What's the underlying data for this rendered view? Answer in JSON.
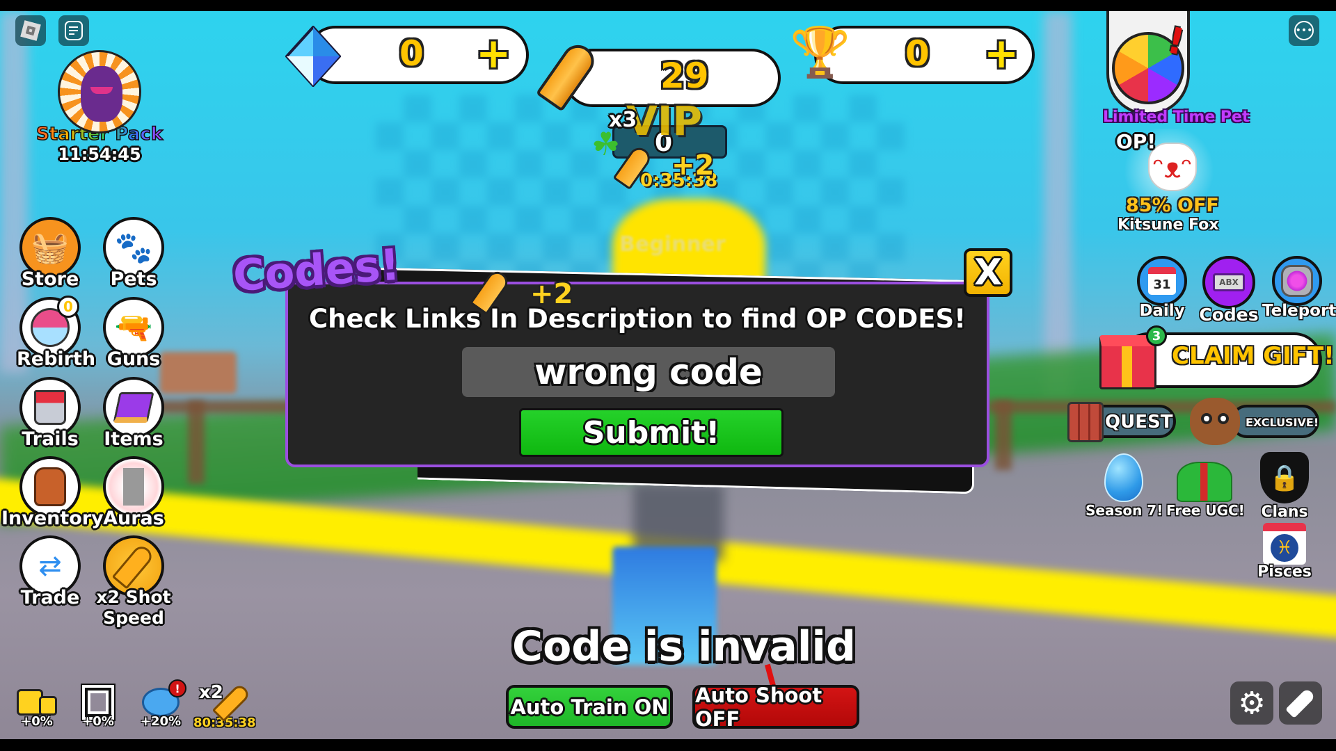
{
  "top_left": {
    "roblox_menu_icon": "roblox-logo-icon",
    "chat_icon": "chat-icon",
    "starter_pack": {
      "label": "Starter Pack",
      "timer": "11:54:45"
    }
  },
  "currencies": {
    "gems": {
      "value": "0",
      "plus": "+"
    },
    "bullets": {
      "value": "29"
    },
    "trophies": {
      "value": "0",
      "plus": "+"
    }
  },
  "hud_center": {
    "vip_label": "VIP",
    "luck_multiplier": "x3",
    "counter": "0",
    "bullet_gain": "+2",
    "timer_partial": "0:35:38",
    "rank_label": "Beginner"
  },
  "limited_pet": {
    "label": "Limited Time Pet",
    "alert": "!",
    "op_label": "OP!",
    "discount": "85% OFF",
    "pet_name": "Kitsune Fox"
  },
  "left_menu": [
    {
      "id": "store",
      "label": "Store",
      "icon": "basket"
    },
    {
      "id": "pets",
      "label": "Pets",
      "icon": "paw"
    },
    {
      "id": "rebirth",
      "label": "Rebirth",
      "icon": "rebirth",
      "badge": "0"
    },
    {
      "id": "guns",
      "label": "Guns",
      "icon": "pistol"
    },
    {
      "id": "trails",
      "label": "Trails",
      "icon": "paint-bucket"
    },
    {
      "id": "items",
      "label": "Items",
      "icon": "book"
    },
    {
      "id": "inventory",
      "label": "Inventory",
      "icon": "backpack"
    },
    {
      "id": "auras",
      "label": "Auras",
      "icon": "aura"
    },
    {
      "id": "trade",
      "label": "Trade",
      "icon": "arrows"
    },
    {
      "id": "shot-speed",
      "label": "x2 Shot Speed",
      "icon": "bullet"
    }
  ],
  "right_menu": {
    "daily": {
      "label": "Daily",
      "calendar_day": "31"
    },
    "codes": {
      "label": "Codes",
      "ticket_text": "ABX"
    },
    "teleport": {
      "label": "Teleport"
    },
    "claim_gift": {
      "label": "CLAIM GIFT!",
      "badge": "3"
    },
    "quest": {
      "label": "QUEST"
    },
    "exclusive": {
      "label": "EXCLUSIVE!"
    },
    "season": {
      "label": "Season 7!"
    },
    "free_ugc": {
      "label": "Free UGC!"
    },
    "clans": {
      "label": "Clans"
    },
    "pisces": {
      "label": "Pisces"
    }
  },
  "dialog": {
    "title": "Codes!",
    "close_label": "X",
    "description": "Check Links In Description to find OP CODES!",
    "code_value": "wrong code",
    "submit_label": "Submit!",
    "floating_gain": "+2"
  },
  "status_message": "Code is invalid",
  "bottom_bar": {
    "boosts": [
      {
        "id": "friends",
        "value": "+0%"
      },
      {
        "id": "group",
        "value": "+0%"
      },
      {
        "id": "speed",
        "value": "+20%",
        "alert": "!"
      },
      {
        "id": "x2-bullets",
        "multiplier": "x2",
        "timer": "80:35:38"
      }
    ],
    "auto_train": {
      "label": "Auto Train ON",
      "state": "on",
      "color": "#22c02a"
    },
    "auto_shoot": {
      "label": "Auto Shoot OFF",
      "state": "off",
      "color": "#c40a0a"
    },
    "settings_icon": "gear-icon",
    "emote_icon": "emote-icon"
  },
  "colors": {
    "dialog_border": "#9b4fe0",
    "dialog_bg": "#252525",
    "title_purple": "#a855f7",
    "close_yellow": "#ffd21f",
    "submit_green": "#1ec422",
    "currency_gold": "#ffc400"
  }
}
